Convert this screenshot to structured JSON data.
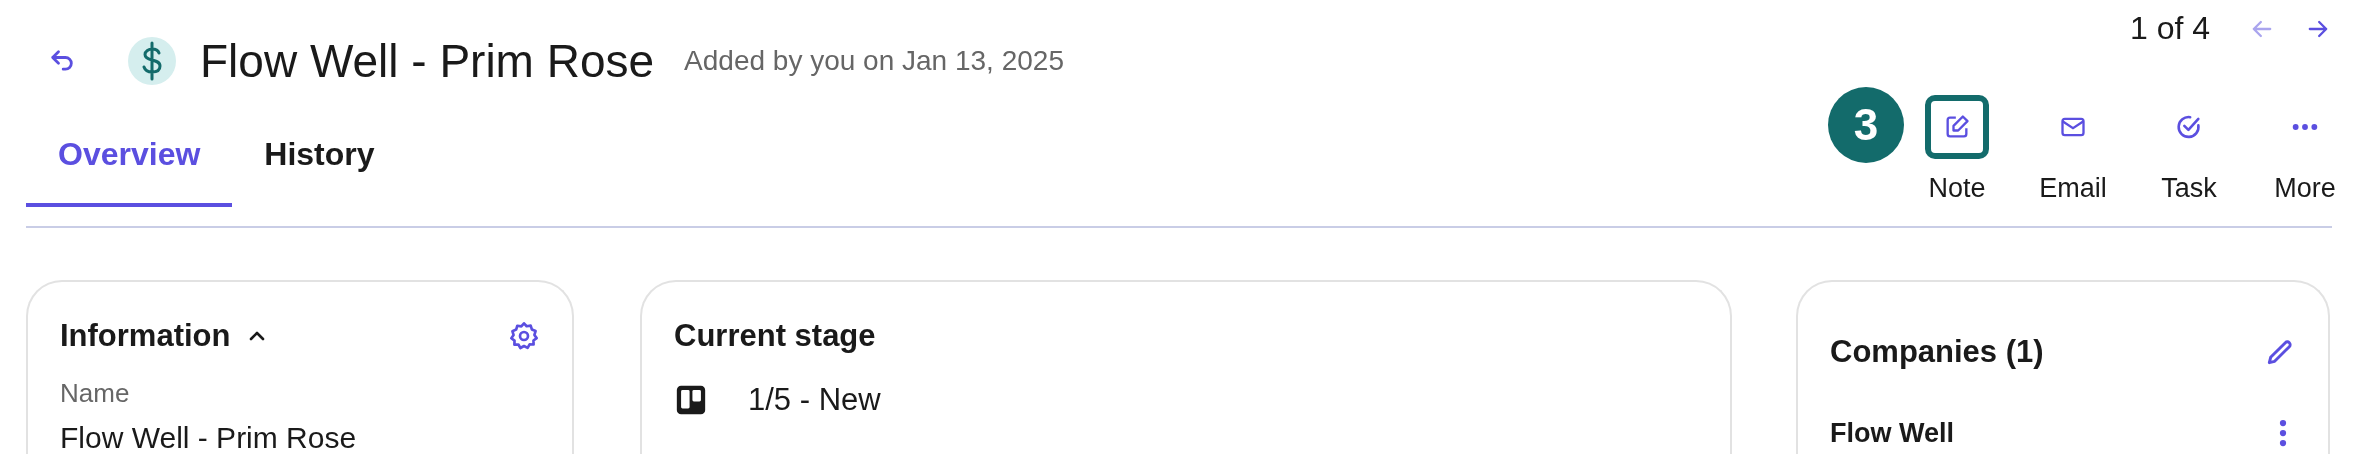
{
  "header": {
    "title": "Flow Well - Prim Rose",
    "subtitle": "Added by you on Jan 13, 2025"
  },
  "pager": {
    "text": "1 of 4",
    "prev_disabled": true,
    "next_disabled": false
  },
  "tabs": [
    {
      "label": "Overview",
      "selected": true
    },
    {
      "label": "History",
      "selected": false
    }
  ],
  "callout": {
    "number": "3"
  },
  "actions": [
    {
      "label": "Note",
      "kind": "note",
      "highlighted": true
    },
    {
      "label": "Email",
      "kind": "email",
      "highlighted": false
    },
    {
      "label": "Task",
      "kind": "task",
      "highlighted": false
    },
    {
      "label": "More",
      "kind": "more",
      "highlighted": false
    }
  ],
  "information": {
    "title": "Information",
    "expanded": true,
    "field_label": "Name",
    "field_value": "Flow Well - Prim Rose"
  },
  "stage": {
    "title": "Current stage",
    "value": "1/5 - New"
  },
  "companies": {
    "title": "Companies (1)",
    "items": [
      "Flow Well"
    ]
  }
}
